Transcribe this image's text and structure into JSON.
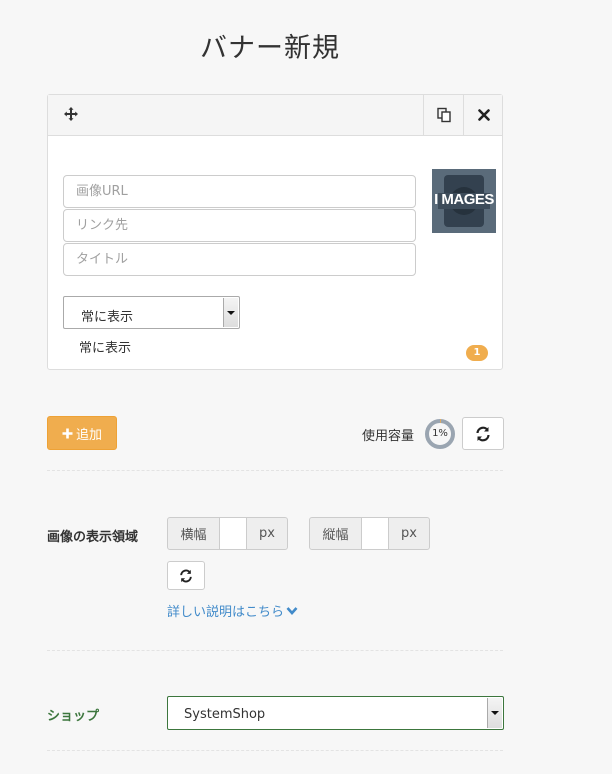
{
  "page": {
    "title": "バナー新規"
  },
  "banner": {
    "image_url_placeholder": "画像URL",
    "link_placeholder": "リンク先",
    "title_placeholder": "タイトル",
    "thumbnail_text": "I MAGES",
    "display_select": {
      "selected": "常に表示"
    },
    "display_label": "常に表示",
    "index_badge": "1"
  },
  "toolbar": {
    "add_label": "追加",
    "usage_label": "使用容量",
    "usage_percent_text": "1%",
    "usage_fraction": 0.01
  },
  "display_area": {
    "label": "画像の表示領域",
    "width_label": "横幅",
    "height_label": "縦幅",
    "unit": "px",
    "help_link": "詳しい説明はこちら"
  },
  "shop": {
    "label": "ショップ",
    "selected": "SystemShop"
  },
  "colors": {
    "accent": "#f0ad4e",
    "link": "#428bca",
    "shop_label": "#3c763d"
  }
}
